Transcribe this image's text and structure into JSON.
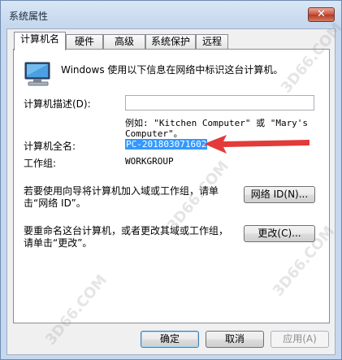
{
  "window": {
    "title": "系统属性",
    "close_label": "✕"
  },
  "tabs": [
    {
      "label": "计算机名",
      "active": true
    },
    {
      "label": "硬件",
      "active": false
    },
    {
      "label": "高级",
      "active": false
    },
    {
      "label": "系统保护",
      "active": false
    },
    {
      "label": "远程",
      "active": false
    }
  ],
  "panel": {
    "info_icon": "computer-icon",
    "intro": "Windows 使用以下信息在网络中标识这台计算机。",
    "description_label": "计算机描述(D):",
    "description_value": "",
    "example_line1": "例如: \"Kitchen Computer\" 或 \"Mary's",
    "example_line2": "Computer\"。",
    "fullname_label": "计算机全名:",
    "fullname_value": "PC-201803071602",
    "workgroup_label": "工作组:",
    "workgroup_value": "WORKGROUP",
    "join_text_line1": "若要使用向导将计算机加入域或工作组，请单",
    "join_text_line2": "击“网络 ID”。",
    "network_id_button": "网络 ID(N)...",
    "rename_text_line1": "要重命名这台计算机，或者更改其域或工作组，",
    "rename_text_line2": "请单击“更改”。",
    "change_button": "更改(C)..."
  },
  "footer": {
    "ok": "确定",
    "cancel": "取消",
    "apply": "应用(A)"
  },
  "watermarks": [
    "3D66.COM",
    "3D66.COM",
    "3D66.COM",
    "3D66.COM"
  ],
  "colors": {
    "highlight": "#3399ff",
    "arrow": "#e33a3a"
  }
}
